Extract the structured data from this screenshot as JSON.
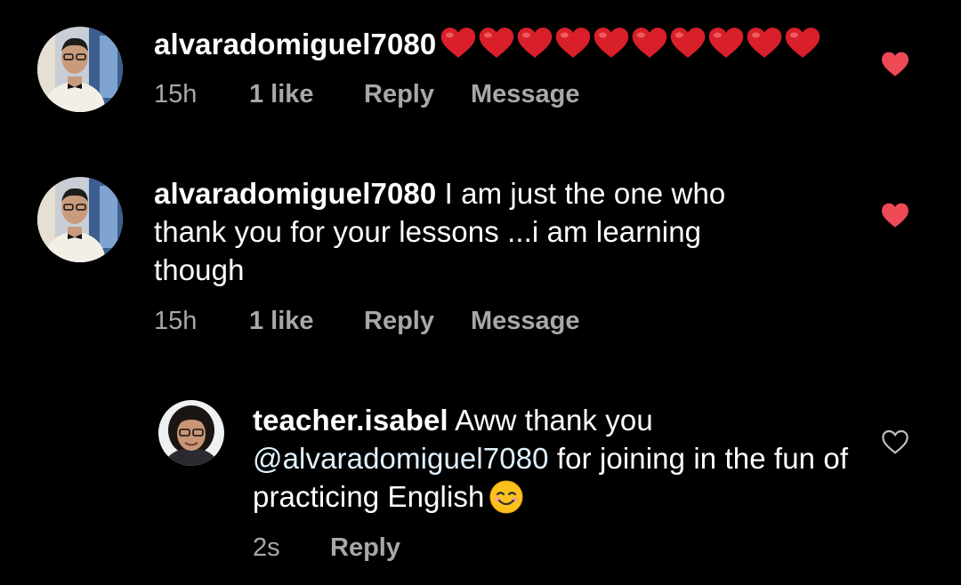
{
  "colors": {
    "background": "#000000",
    "heart_red": "#ed4956",
    "meta_gray": "#a8a8a8",
    "mention_blue": "#e0f1ff"
  },
  "comments": [
    {
      "username": "alvaradomiguel7080",
      "text": "",
      "inline_icon": "red-heart-emoji-x10",
      "time": "15h",
      "likes": "1 like",
      "reply": "Reply",
      "message": "Message",
      "liked": true,
      "avatar_icon": "user-avatar"
    },
    {
      "username": "alvaradomiguel7080",
      "text": " I am just the one who thank you for your lessons ...i am learning though",
      "time": "15h",
      "likes": "1 like",
      "reply": "Reply",
      "message": "Message",
      "liked": true,
      "avatar_icon": "user-avatar"
    },
    {
      "username": "teacher.isabel",
      "text_before": " Aww thank you ",
      "mention": "@alvaradomiguel7080",
      "text_after": " for joining in the fun of practicing English",
      "inline_icon": "smiling-face-emoji",
      "time": "2s",
      "reply": "Reply",
      "liked": false,
      "avatar_icon": "user-avatar"
    }
  ]
}
